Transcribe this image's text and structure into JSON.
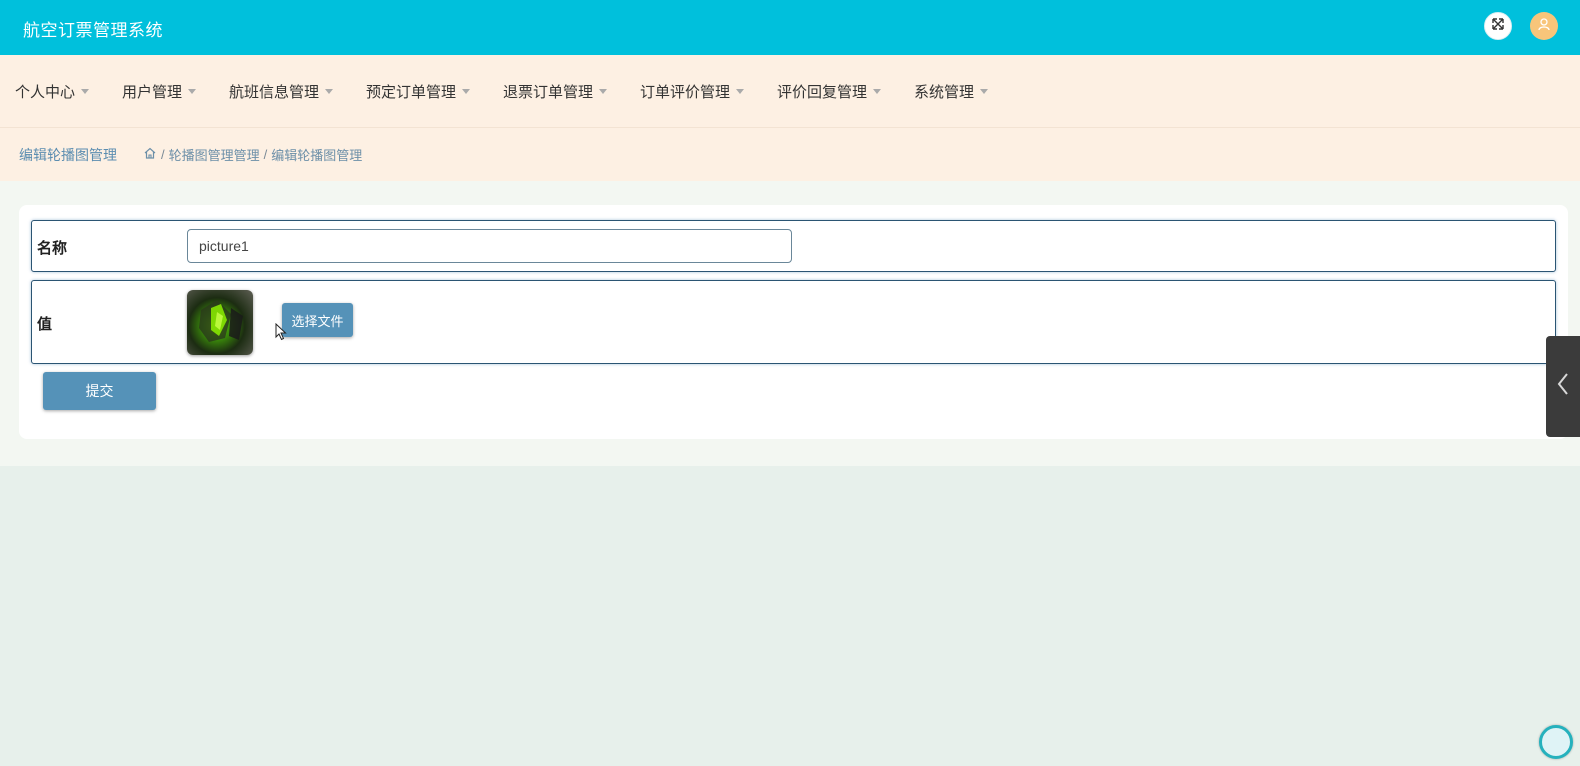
{
  "app": {
    "title": "航空订票管理系统"
  },
  "header": {
    "fullscreen_icon": "expand-icon",
    "avatar_icon": "user-icon"
  },
  "nav": {
    "items": [
      {
        "label": "个人中心"
      },
      {
        "label": "用户管理"
      },
      {
        "label": "航班信息管理"
      },
      {
        "label": "预定订单管理"
      },
      {
        "label": "退票订单管理"
      },
      {
        "label": "订单评价管理"
      },
      {
        "label": "评价回复管理"
      },
      {
        "label": "系统管理"
      }
    ]
  },
  "page": {
    "title": "编辑轮播图管理",
    "breadcrumb": {
      "home_icon": "home-icon",
      "level1": "轮播图管理管理",
      "separator": "/",
      "level2": "编辑轮播图管理"
    }
  },
  "form": {
    "name_label": "名称",
    "name_value": "picture1",
    "value_label": "值",
    "choose_file_label": "选择文件",
    "submit_label": "提交"
  },
  "side_toggle": {
    "icon": "chevron-left-icon"
  },
  "colors": {
    "header": "#00c0dc",
    "nav_bg": "#fdf0e3",
    "primary_button": "#5592b8",
    "avatar": "#f8c57a"
  }
}
